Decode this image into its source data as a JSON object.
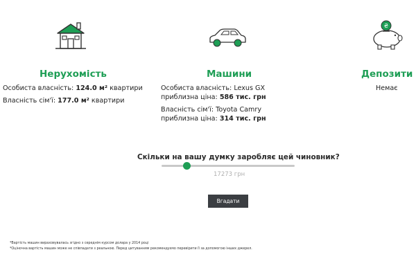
{
  "colors": {
    "accent": "#1e9e55",
    "button_bg": "#3b3e42"
  },
  "real_estate": {
    "icon": "house-icon",
    "title": "Нерухомість",
    "personal_label": "Особиста власність: ",
    "personal_value": "124.0 м²",
    "personal_suffix": " квартири",
    "family_label": "Власність сім'ї: ",
    "family_value": "177.0 м²",
    "family_suffix": " квартири"
  },
  "cars": {
    "icon": "car-icon",
    "title": "Машини",
    "personal_label": "Особиста власність: Lexus GX",
    "personal_price_label": "приблизна ціна: ",
    "personal_price_value": "586 тис. грн",
    "family_label": "Власність сім'ї: Toyota Camry",
    "family_price_label": "приблизна ціна: ",
    "family_price_value": "314 тис. грн"
  },
  "deposits": {
    "icon": "piggy-bank-icon",
    "title": "Депозити",
    "value": "Немає"
  },
  "guess": {
    "question": "Скільки на вашу думку заробляє цей чиновник?",
    "slider_fraction": 0.19,
    "amount": "17273 грн",
    "button_label": "Вгадати"
  },
  "footnotes": [
    "*Вартість машин вираховувалась згідно з середнім курсом долара у 2014 році",
    "*Оціночна вартість машин може не співпадати з реальною. Перед цитуванням рекомендуємо перевірити її за допомогою інших джерел."
  ]
}
